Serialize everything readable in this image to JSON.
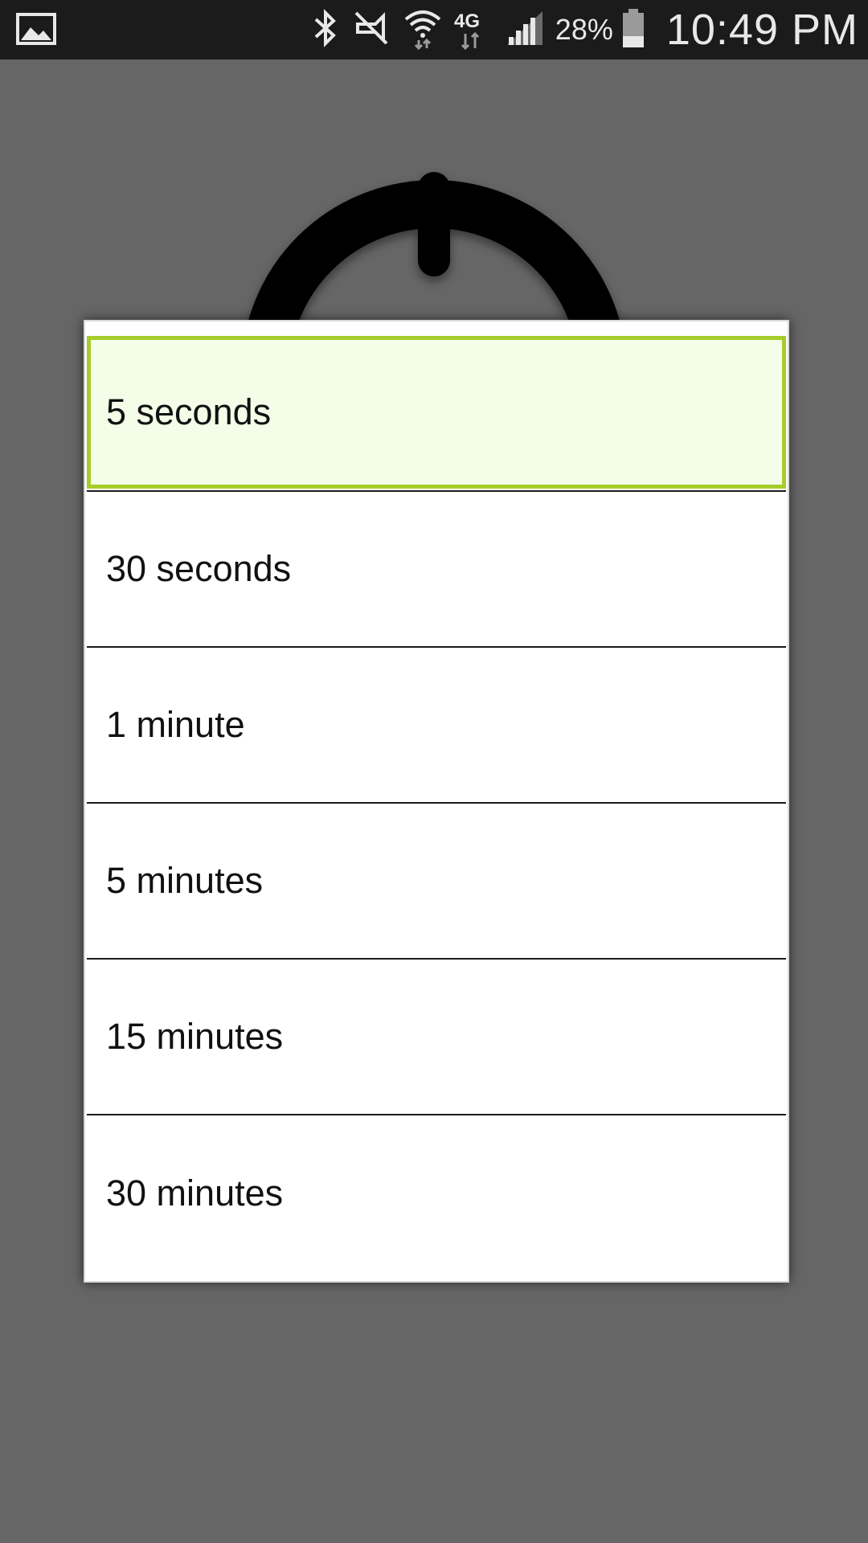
{
  "status_bar": {
    "battery_percent": "28%",
    "time": "10:49 PM",
    "network_label": "4G",
    "icons": [
      "gallery-icon",
      "bluetooth-icon",
      "vibrate-off-icon",
      "wifi-icon",
      "4g-lte-icon",
      "signal-icon",
      "battery-icon"
    ]
  },
  "dialog": {
    "options": [
      {
        "label": "5 seconds",
        "selected": true
      },
      {
        "label": "30 seconds",
        "selected": false
      },
      {
        "label": "1 minute",
        "selected": false
      },
      {
        "label": "5 minutes",
        "selected": false
      },
      {
        "label": "15 minutes",
        "selected": false
      },
      {
        "label": "30 minutes",
        "selected": false
      }
    ]
  },
  "colors": {
    "selected_border": "#a6cc2c",
    "selected_background": "#f4fde8",
    "scrim": "#666666",
    "status_bar": "#1b1b1b"
  }
}
